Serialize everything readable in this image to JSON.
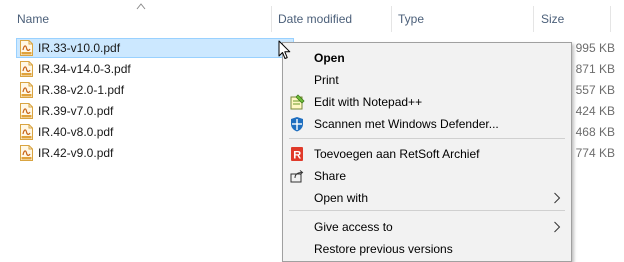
{
  "columns": {
    "name": "Name",
    "date_modified": "Date modified",
    "type": "Type",
    "size": "Size"
  },
  "files": [
    {
      "name": "IR.33-v10.0.pdf",
      "size": "995 KB",
      "selected": true
    },
    {
      "name": "IR.34-v14.0-3.pdf",
      "size": "871 KB",
      "selected": false
    },
    {
      "name": "IR.38-v2.0-1.pdf",
      "size": "557 KB",
      "selected": false
    },
    {
      "name": "IR.39-v7.0.pdf",
      "size": "424 KB",
      "selected": false
    },
    {
      "name": "IR.40-v8.0.pdf",
      "size": "468 KB",
      "selected": false
    },
    {
      "name": "IR.42-v9.0.pdf",
      "size": "774 KB",
      "selected": false
    }
  ],
  "context_menu": {
    "items": [
      {
        "label": "Open",
        "bold": true,
        "icon": "",
        "submenu": false
      },
      {
        "label": "Print",
        "bold": false,
        "icon": "",
        "submenu": false
      },
      {
        "label": "Edit with Notepad++",
        "bold": false,
        "icon": "notepad-plus-plus-icon",
        "submenu": false
      },
      {
        "label": "Scannen met Windows Defender...",
        "bold": false,
        "icon": "windows-defender-icon",
        "submenu": false
      },
      {
        "label": "Toevoegen aan RetSoft Archief",
        "bold": false,
        "icon": "retsoft-archief-icon",
        "submenu": false
      },
      {
        "label": "Share",
        "bold": false,
        "icon": "share-icon",
        "submenu": false
      },
      {
        "label": "Open with",
        "bold": false,
        "icon": "",
        "submenu": true
      },
      {
        "label": "Give access to",
        "bold": false,
        "icon": "",
        "submenu": true
      },
      {
        "label": "Restore previous versions",
        "bold": false,
        "icon": "",
        "submenu": false
      }
    ]
  },
  "colors": {
    "selection_fill": "#cce8ff",
    "selection_border": "#99d1ff",
    "header_text": "#4c607a",
    "menu_background": "#f2f2f2"
  }
}
